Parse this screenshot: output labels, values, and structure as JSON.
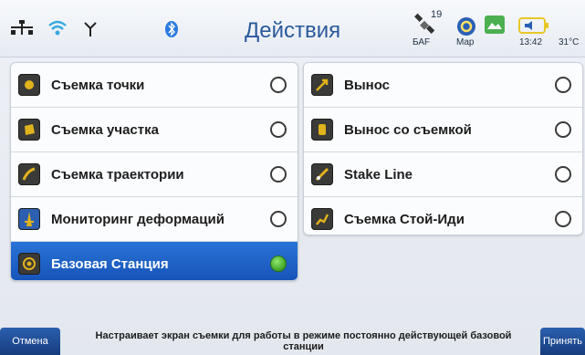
{
  "header": {
    "title": "Действия",
    "satellite_count": "19",
    "gps_status": "БАF",
    "map_label": "Map",
    "time": "13:42",
    "temperature": "31°C",
    "icons": [
      "network-icon",
      "wifi-icon",
      "antenna-icon",
      "bluetooth-icon",
      "satellite-icon",
      "map-icon",
      "camera-icon",
      "battery-icon"
    ]
  },
  "actions_left": [
    {
      "label": "Съемка точки",
      "icon": "survey-point-icon",
      "selected": false
    },
    {
      "label": "Съемка участка",
      "icon": "survey-area-icon",
      "selected": false
    },
    {
      "label": "Съемка траектории",
      "icon": "survey-track-icon",
      "selected": false
    },
    {
      "label": "Мониторинг деформаций",
      "icon": "monitoring-icon",
      "selected": false
    },
    {
      "label": "Базовая Станция",
      "icon": "base-station-icon",
      "selected": true
    }
  ],
  "actions_right": [
    {
      "label": "Вынос",
      "icon": "stakeout-icon",
      "selected": false
    },
    {
      "label": "Вынос со съемкой",
      "icon": "stakeout-survey-icon",
      "selected": false
    },
    {
      "label": "Stake Line",
      "icon": "stake-line-icon",
      "selected": false
    },
    {
      "label": "Съемка Стой-Иди",
      "icon": "stop-go-icon",
      "selected": false
    }
  ],
  "footer": {
    "cancel_label": "Отмена",
    "accept_label": "Принять",
    "hint": "Настраивает экран съемки для работы в режиме постоянно действующей базовой станции"
  },
  "colors": {
    "accent": "#1d5fc4",
    "selected_radio": "#4caf2e"
  }
}
